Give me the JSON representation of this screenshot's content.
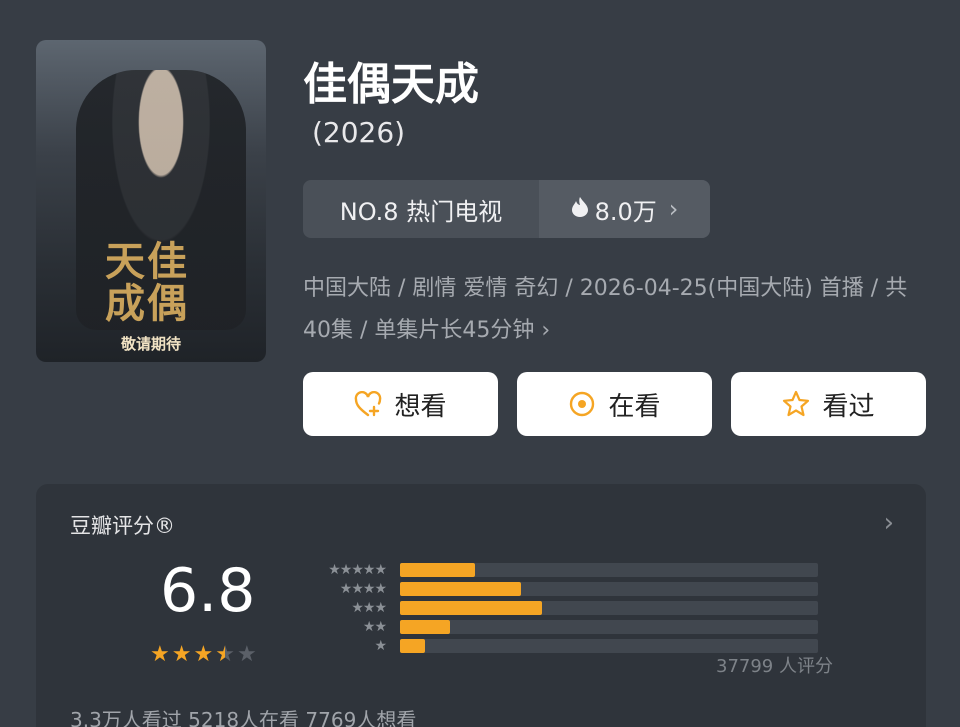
{
  "poster": {
    "title": "佳偶天成",
    "tag": "敬请期待"
  },
  "show": {
    "title": "佳偶天成",
    "year": "(2026)",
    "rank_label": "NO.8 热门电视",
    "heat": "8.0万",
    "meta": "中国大陆 / 剧情 爱情 奇幻 / 2026-04-25(中国大陆) 首播 / 共40集 / 单集片长45分钟"
  },
  "actions": {
    "want": "想看",
    "watching": "在看",
    "watched": "看过"
  },
  "rating": {
    "label": "豆瓣评分®",
    "score": "6.8",
    "stars_value": 3.5,
    "count_text": "37799 人评分",
    "distribution": [
      {
        "stars": "★★★★★",
        "fraction": 0.18
      },
      {
        "stars": "★★★★",
        "fraction": 0.29
      },
      {
        "stars": "★★★",
        "fraction": 0.34
      },
      {
        "stars": "★★",
        "fraction": 0.12
      },
      {
        "stars": "★",
        "fraction": 0.06
      }
    ]
  },
  "summary": "3.3万人看过 5218人在看 7769人想看",
  "colors": {
    "accent": "#f5a524",
    "background": "#373d45",
    "card": "#2f343b"
  }
}
